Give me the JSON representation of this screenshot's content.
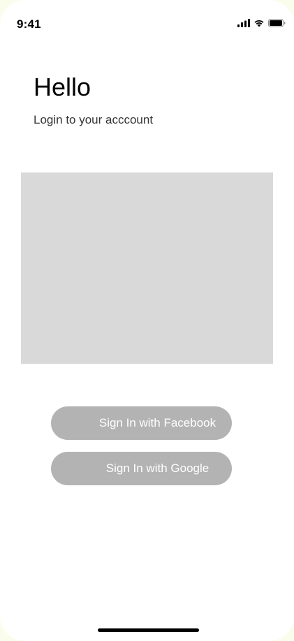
{
  "status_bar": {
    "time": "9:41",
    "icons": [
      "signal-icon",
      "wifi-icon",
      "battery-icon"
    ]
  },
  "header": {
    "title": "Hello",
    "subtitle": "Login to your acccount"
  },
  "buttons": {
    "facebook_label": "Sign In with Facebook",
    "google_label": "Sign In with Google"
  },
  "colors": {
    "background": "#ffffff",
    "placeholder": "#d9d9d9",
    "button": "#b3b3b3",
    "button_text": "#ffffff"
  }
}
